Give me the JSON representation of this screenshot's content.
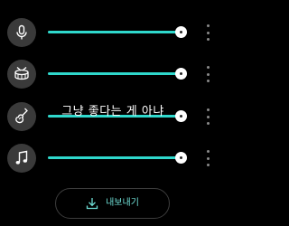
{
  "tracks": [
    {
      "name": "vocal",
      "icon": "microphone-icon",
      "level": 1.0
    },
    {
      "name": "drums",
      "icon": "drum-icon",
      "level": 1.0
    },
    {
      "name": "bass",
      "icon": "bass-guitar-icon",
      "level": 1.0
    },
    {
      "name": "other",
      "icon": "music-note-icon",
      "level": 1.0
    }
  ],
  "caption": "그냥 좋다는 게 아냐",
  "export_button": {
    "label": "내보내기",
    "icon": "download-icon"
  },
  "colors": {
    "accent": "#2fd8cc",
    "icon_circle": "#3a3a3a",
    "background": "#000000"
  }
}
